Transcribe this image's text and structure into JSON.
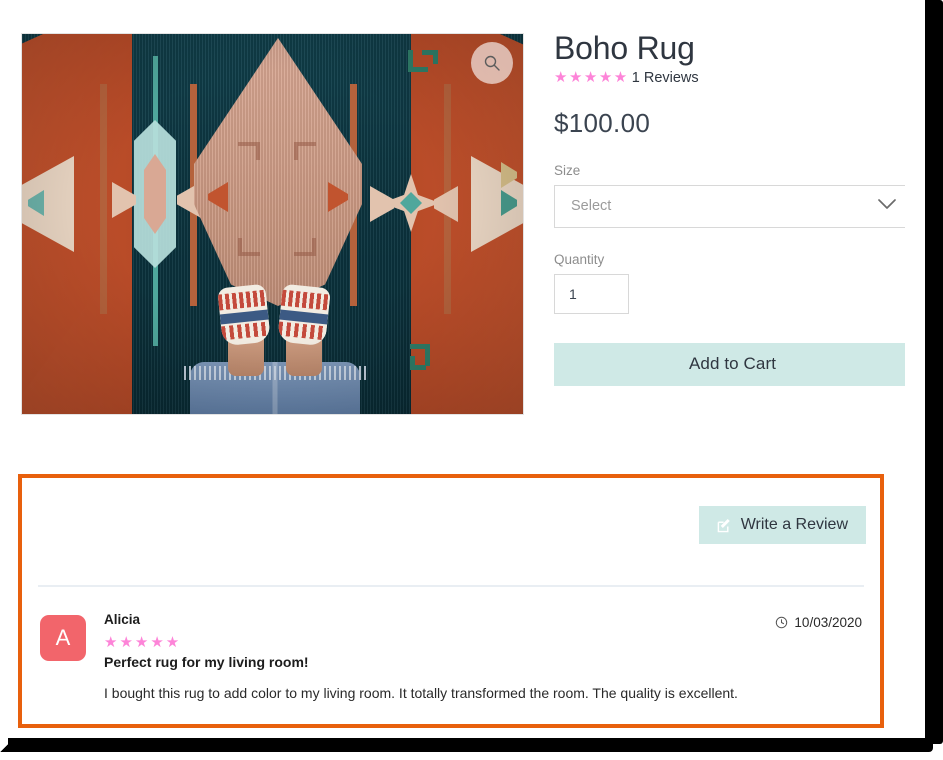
{
  "product": {
    "title": "Boho Rug",
    "stars": "★★★★★",
    "review_count_label": "1 Reviews",
    "price": "$100.00",
    "size_label": "Size",
    "size_value": "Select",
    "quantity_label": "Quantity",
    "quantity_value": "1",
    "add_to_cart_label": "Add to Cart",
    "zoom_icon": "search-icon",
    "image_alt": "Boho kilim rug with teal field, coral diamonds, feet in patterned slippers"
  },
  "reviews": {
    "write_review_label": "Write a Review",
    "write_review_icon": "edit-square-icon",
    "items": [
      {
        "avatar_initial": "A",
        "name": "Alicia",
        "stars": "★★★★★",
        "title": "Perfect rug for my living room!",
        "text": "I bought this rug to add color to my living room. It totally transformed the room. The quality is excellent.",
        "date": "10/03/2020",
        "date_icon": "clock-icon"
      }
    ]
  },
  "colors": {
    "star_pink": "#fd84d8",
    "button_mint": "#cfe9e6",
    "avatar_coral": "#f2656b",
    "annotation_orange": "#e8600d",
    "text_dark": "#2f3640",
    "label_gray": "#8d8d8d"
  }
}
